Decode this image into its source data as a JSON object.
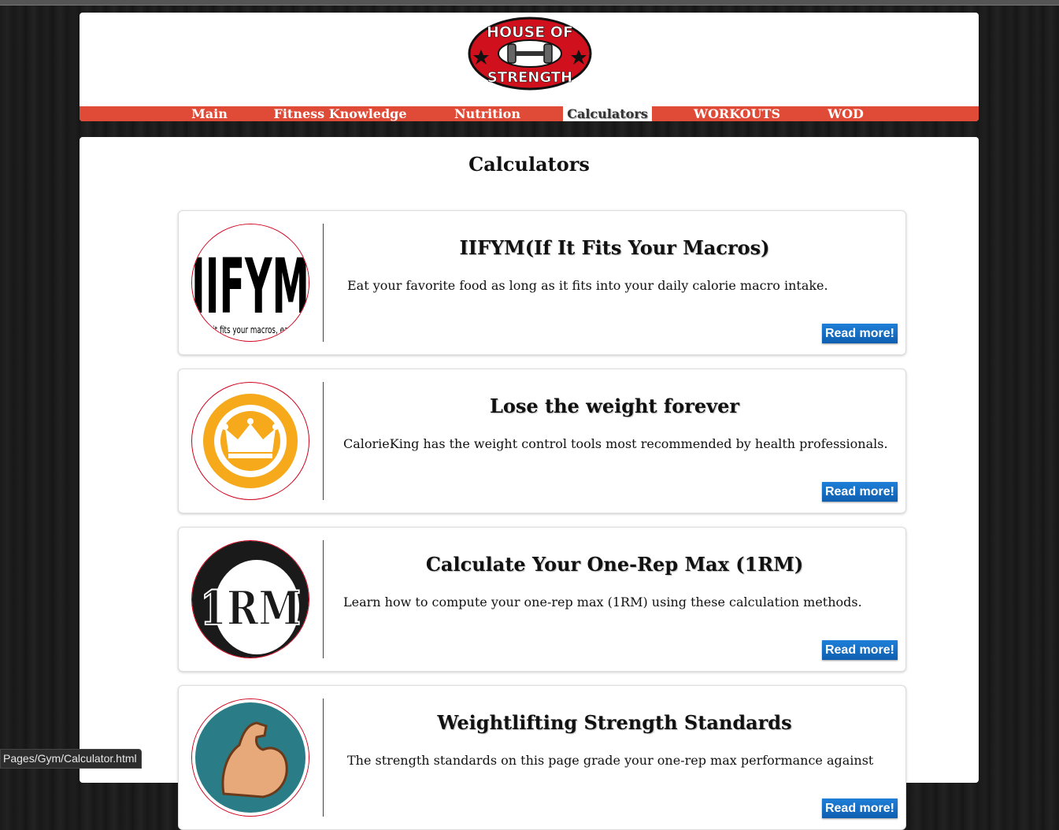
{
  "header": {
    "logo_text_top": "HOUSE OF",
    "logo_text_bottom": "STRENGTH",
    "colors": {
      "brand_red": "#e04b37",
      "logo_red": "#d0101c"
    }
  },
  "nav": {
    "items": [
      {
        "label": "Main",
        "active": false
      },
      {
        "label": "Fitness Knowledge",
        "active": false
      },
      {
        "label": "Nutrition",
        "active": false
      },
      {
        "label": "Calculators",
        "active": true
      },
      {
        "label": "WORKOUTS",
        "active": false
      },
      {
        "label": "WOD",
        "active": false
      }
    ]
  },
  "main": {
    "title": "Calculators",
    "cards": [
      {
        "title": "IIFYM(If It Fits Your Macros)",
        "description": "Eat your favorite food as long as it fits into your daily calorie macro intake.",
        "button": "Read more!",
        "image_text": "IIFYM",
        "image_caption": "if it fits your macros, eat it!"
      },
      {
        "title": "Lose the weight forever",
        "description": "CalorieKing has the weight control tools most recommended by health professionals.",
        "button": "Read more!",
        "image_icon": "crown-icon"
      },
      {
        "title": "Calculate Your One-Rep Max (1RM)",
        "description": "Learn how to compute your one-rep max (1RM) using these calculation methods.",
        "button": "Read more!",
        "image_text": "1RM"
      },
      {
        "title": "Weightlifting Strength Standards",
        "description": "The strength standards on this page grade your one-rep max performance against",
        "button": "Read more!",
        "image_icon": "flexed-arm-icon"
      }
    ]
  },
  "status_bar": {
    "url": "Pages/Gym/Calculator.html"
  },
  "colors": {
    "button_blue": "#1670c8",
    "accent_red": "#d0021b",
    "crown_gold": "#f5a91b",
    "teal": "#2a7c86"
  }
}
